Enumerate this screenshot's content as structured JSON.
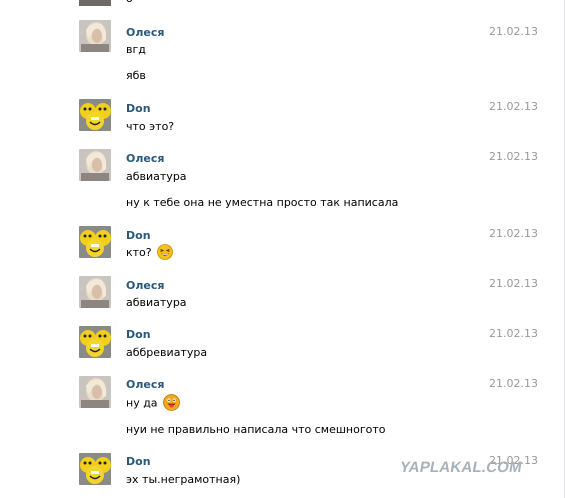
{
  "partial_top_text": "o",
  "messages": [
    {
      "author": "Олеся",
      "date": "21.02.13",
      "lines": [
        "вгд",
        "ябв"
      ],
      "avatar": "photo-avatar-olesya"
    },
    {
      "author": "Don",
      "date": "21.02.13",
      "lines": [
        "что это?"
      ],
      "avatar": "smiley-avatar-don"
    },
    {
      "author": "Олеся",
      "date": "21.02.13",
      "lines": [
        "абвиатура",
        "ну к тебе она не уместна просто так написала"
      ],
      "avatar": "photo-avatar-olesya"
    },
    {
      "author": "Don",
      "date": "21.02.13",
      "lines": [
        "кто?"
      ],
      "emoji": "laughing-emoji",
      "avatar": "smiley-avatar-don"
    },
    {
      "author": "Олеся",
      "date": "21.02.13",
      "lines": [
        "абвиатура"
      ],
      "avatar": "photo-avatar-olesya"
    },
    {
      "author": "Don",
      "date": "21.02.13",
      "lines": [
        "аббревиатура"
      ],
      "avatar": "smiley-avatar-don"
    },
    {
      "author": "Олеся",
      "date": "21.02.13",
      "lines": [
        "ну да",
        "нуи не правильно написала что смешногото"
      ],
      "emoji": "tongue-emoji",
      "avatar": "photo-avatar-olesya"
    },
    {
      "author": "Don",
      "date": "21.02.13",
      "lines": [
        "эх ты.неграмотная)"
      ],
      "avatar": "smiley-avatar-don"
    }
  ],
  "watermark": "YAPLAKAL.COM",
  "colors": {
    "author": "#2b587a",
    "date": "#999999",
    "text": "#000000",
    "watermark": "#a7b0bb"
  }
}
